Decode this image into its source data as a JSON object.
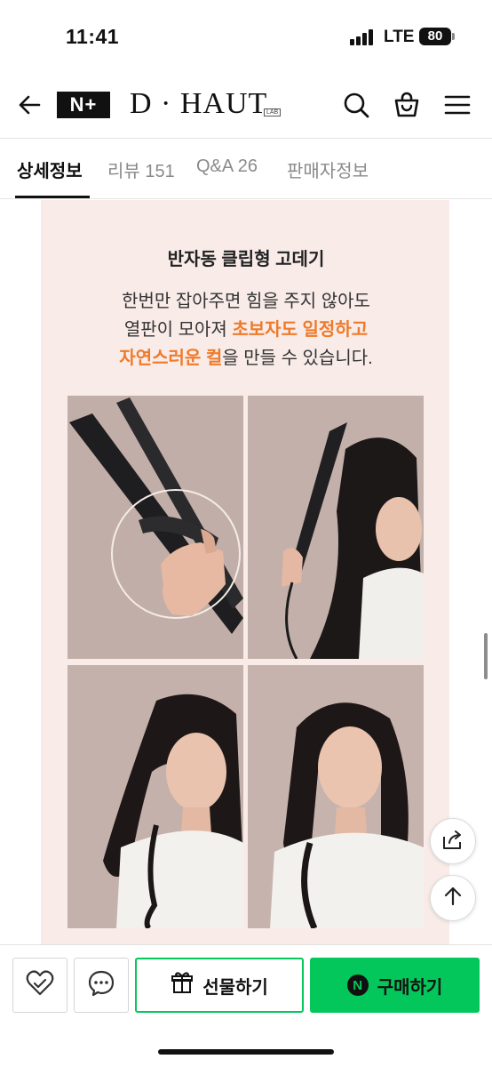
{
  "status": {
    "time": "11:41",
    "network": "LTE",
    "battery": "80"
  },
  "header": {
    "badge": "N+",
    "brand": "D · HAUT",
    "brand_sub": "LAB"
  },
  "tabs": [
    {
      "label": "상세정보",
      "active": true
    },
    {
      "label": "리뷰 151",
      "active": false
    },
    {
      "label": "Q&A 26",
      "active": false
    },
    {
      "label": "판매자정보",
      "active": false
    }
  ],
  "content": {
    "title": "반자동 클립형 고데기",
    "line1": "한번만 잡아주면 힘을 주지 않아도",
    "line2_plain": "열판이 모아져 ",
    "line2_highlight": "초보자도 일정하고",
    "line3_highlight": "자연스러운 컬",
    "line3_plain": "을 만들 수 있습니다.",
    "highlight_color": "#ef7a2a"
  },
  "icons": [
    "back-arrow-icon",
    "search-icon",
    "cart-icon",
    "menu-icon",
    "share-icon",
    "arrow-up-icon",
    "wishlist-heart-icon",
    "chat-icon",
    "gift-icon",
    "naver-n-icon"
  ],
  "bottom": {
    "gift_label": "선물하기",
    "buy_label": "구매하기",
    "buy_badge": "N",
    "accent": "#03c75a"
  }
}
